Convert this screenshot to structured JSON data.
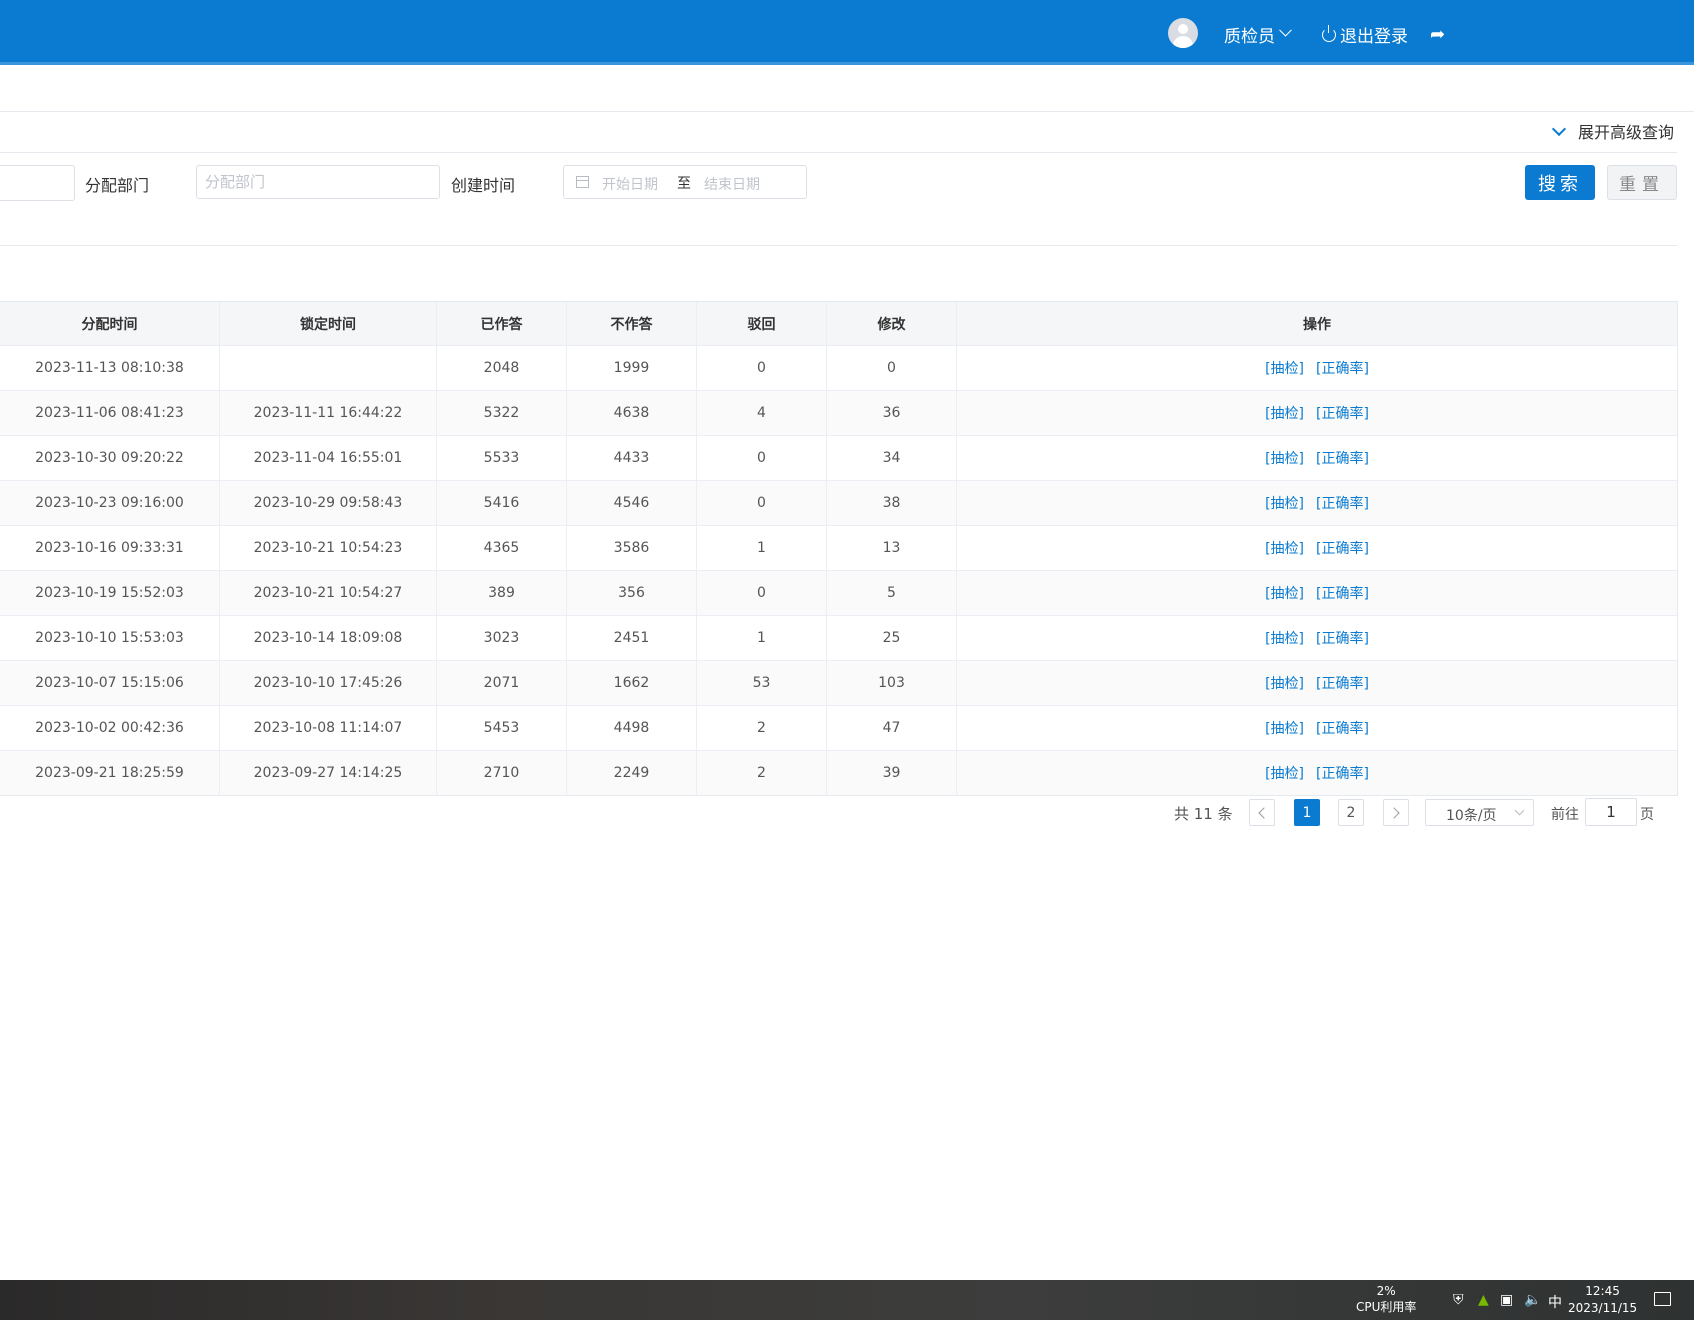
{
  "header": {
    "user_label": "质检员",
    "logout_label": "退出登录"
  },
  "advanced_query_label": "展开高级查询",
  "search": {
    "dept_label": "分配部门",
    "dept_placeholder": "分配部门",
    "created_label": "创建时间",
    "start_placeholder": "开始日期",
    "range_sep": "至",
    "end_placeholder": "结束日期",
    "search_button": "搜索",
    "reset_button": "重置"
  },
  "table": {
    "columns": [
      "分配时间",
      "锁定时间",
      "已作答",
      "不作答",
      "驳回",
      "修改",
      "操作"
    ],
    "rows": [
      {
        "assign": "2023-11-13 08:10:38",
        "lock": "",
        "answered": "2048",
        "unanswered": "1999",
        "rejected": "0",
        "modified": "0"
      },
      {
        "assign": "2023-11-06 08:41:23",
        "lock": "2023-11-11 16:44:22",
        "answered": "5322",
        "unanswered": "4638",
        "rejected": "4",
        "modified": "36"
      },
      {
        "assign": "2023-10-30 09:20:22",
        "lock": "2023-11-04 16:55:01",
        "answered": "5533",
        "unanswered": "4433",
        "rejected": "0",
        "modified": "34"
      },
      {
        "assign": "2023-10-23 09:16:00",
        "lock": "2023-10-29 09:58:43",
        "answered": "5416",
        "unanswered": "4546",
        "rejected": "0",
        "modified": "38"
      },
      {
        "assign": "2023-10-16 09:33:31",
        "lock": "2023-10-21 10:54:23",
        "answered": "4365",
        "unanswered": "3586",
        "rejected": "1",
        "modified": "13"
      },
      {
        "assign": "2023-10-19 15:52:03",
        "lock": "2023-10-21 10:54:27",
        "answered": "389",
        "unanswered": "356",
        "rejected": "0",
        "modified": "5"
      },
      {
        "assign": "2023-10-10 15:53:03",
        "lock": "2023-10-14 18:09:08",
        "answered": "3023",
        "unanswered": "2451",
        "rejected": "1",
        "modified": "25"
      },
      {
        "assign": "2023-10-07 15:15:06",
        "lock": "2023-10-10 17:45:26",
        "answered": "2071",
        "unanswered": "1662",
        "rejected": "53",
        "modified": "103"
      },
      {
        "assign": "2023-10-02 00:42:36",
        "lock": "2023-10-08 11:14:07",
        "answered": "5453",
        "unanswered": "4498",
        "rejected": "2",
        "modified": "47"
      },
      {
        "assign": "2023-09-21 18:25:59",
        "lock": "2023-09-27 14:14:25",
        "answered": "2710",
        "unanswered": "2249",
        "rejected": "2",
        "modified": "39"
      }
    ],
    "action_sample": "[抽检]",
    "action_accuracy": "[正确率]"
  },
  "pagination": {
    "total_text": "共 11 条",
    "pages": [
      "1",
      "2"
    ],
    "current_page": "1",
    "page_size": "10条/页",
    "goto_label": "前往",
    "goto_value": "1",
    "goto_suffix": "页"
  },
  "taskbar": {
    "cpu_value": "2%",
    "cpu_label": "CPU利用率",
    "ime": "中",
    "time": "12:45",
    "date": "2023/11/15"
  },
  "colors": {
    "primary": "#0a7bd1",
    "header_bg": "#0a7bd1",
    "table_header_bg": "#f5f6f8"
  },
  "icons": [
    "user-avatar-icon",
    "chevron-down-icon",
    "power-icon",
    "share-icon",
    "calendar-icon",
    "chevron-left-icon",
    "chevron-right-icon"
  ]
}
